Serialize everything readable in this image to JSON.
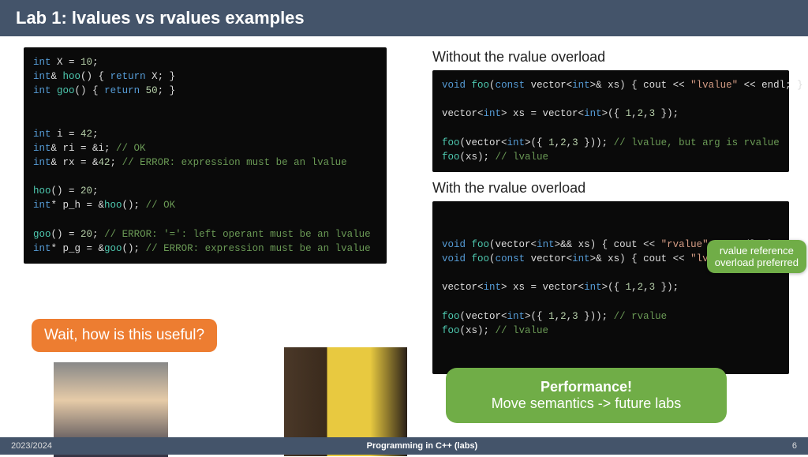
{
  "header": {
    "title": "Lab 1: lvalues vs rvalues examples"
  },
  "left": {
    "code_html": "<span class='kw'>int</span> X = <span class='num'>10</span>;\n<span class='kw'>int</span>&amp; <span class='fn'>hoo</span>() { <span class='kw'>return</span> X; }\n<span class='kw'>int</span> <span class='fn'>goo</span>() { <span class='kw'>return</span> <span class='num'>50</span>; }\n\n\n<span class='kw'>int</span> i = <span class='num'>42</span>;\n<span class='kw'>int</span>&amp; ri = &amp;i; <span class='cm'>// OK</span>\n<span class='kw'>int</span>&amp; rx = &amp;<span class='num'>42</span>; <span class='cm'>// ERROR: expression must be an lvalue</span>\n\n<span class='fn'>hoo</span>() = <span class='num'>20</span>;\n<span class='kw'>int</span>* p_h = &amp;<span class='fn'>hoo</span>(); <span class='cm'>// OK</span>\n\n<span class='fn'>goo</span>() = <span class='num'>20</span>; <span class='cm'>// ERROR: '=': left operant must be an lvalue</span>\n<span class='kw'>int</span>* p_g = &amp;<span class='fn'>goo</span>(); <span class='cm'>// ERROR: expression must be an lvalue</span>\n"
  },
  "right": {
    "sec1": "Without the rvalue overload",
    "code1_html": "<span class='kw'>void</span> <span class='fn'>foo</span>(<span class='kw'>const</span> vector&lt;<span class='kw'>int</span>&gt;&amp; xs) { cout &lt;&lt; <span class='str'>\"lvalue\"</span> &lt;&lt; endl; }\n\nvector&lt;<span class='kw'>int</span>&gt; xs = vector&lt;<span class='kw'>int</span>&gt;({ <span class='num'>1</span>,<span class='num'>2</span>,<span class='num'>3</span> });\n\n<span class='fn'>foo</span>(vector&lt;<span class='kw'>int</span>&gt;({ <span class='num'>1</span>,<span class='num'>2</span>,<span class='num'>3</span> })); <span class='cm'>// lvalue, but arg is rvalue</span>\n<span class='fn'>foo</span>(xs); <span class='cm'>// lvalue</span>",
    "sec2": "With the rvalue overload",
    "code2_html": "<span class='kw'>void</span> <span class='fn'>foo</span>(vector&lt;<span class='kw'>int</span>&gt;&amp;&amp; xs) { cout &lt;&lt; <span class='str'>\"rvalue\"</span> &lt;&lt; endl; }\n<span class='kw'>void</span> <span class='fn'>foo</span>(<span class='kw'>const</span> vector&lt;<span class='kw'>int</span>&gt;&amp; xs) { cout &lt;&lt; <span class='str'>\"lvalue\"</span> &lt;&lt; endl; }\n\nvector&lt;<span class='kw'>int</span>&gt; xs = vector&lt;<span class='kw'>int</span>&gt;({ <span class='num'>1</span>,<span class='num'>2</span>,<span class='num'>3</span> });\n\n<span class='fn'>foo</span>(vector&lt;<span class='kw'>int</span>&gt;({ <span class='num'>1</span>,<span class='num'>2</span>,<span class='num'>3</span> })); <span class='cm'>// rvalue</span>\n<span class='fn'>foo</span>(xs); <span class='cm'>// lvalue</span>"
  },
  "callouts": {
    "orange": "Wait, how is this useful?",
    "green_small_l1": "rvalue reference",
    "green_small_l2": "overload preferred",
    "green_big_l1": "Performance!",
    "green_big_l2": "Move semantics -> future labs"
  },
  "footer": {
    "left": "2023/2024",
    "mid": "Programming in C++ (labs)",
    "right": "6"
  }
}
